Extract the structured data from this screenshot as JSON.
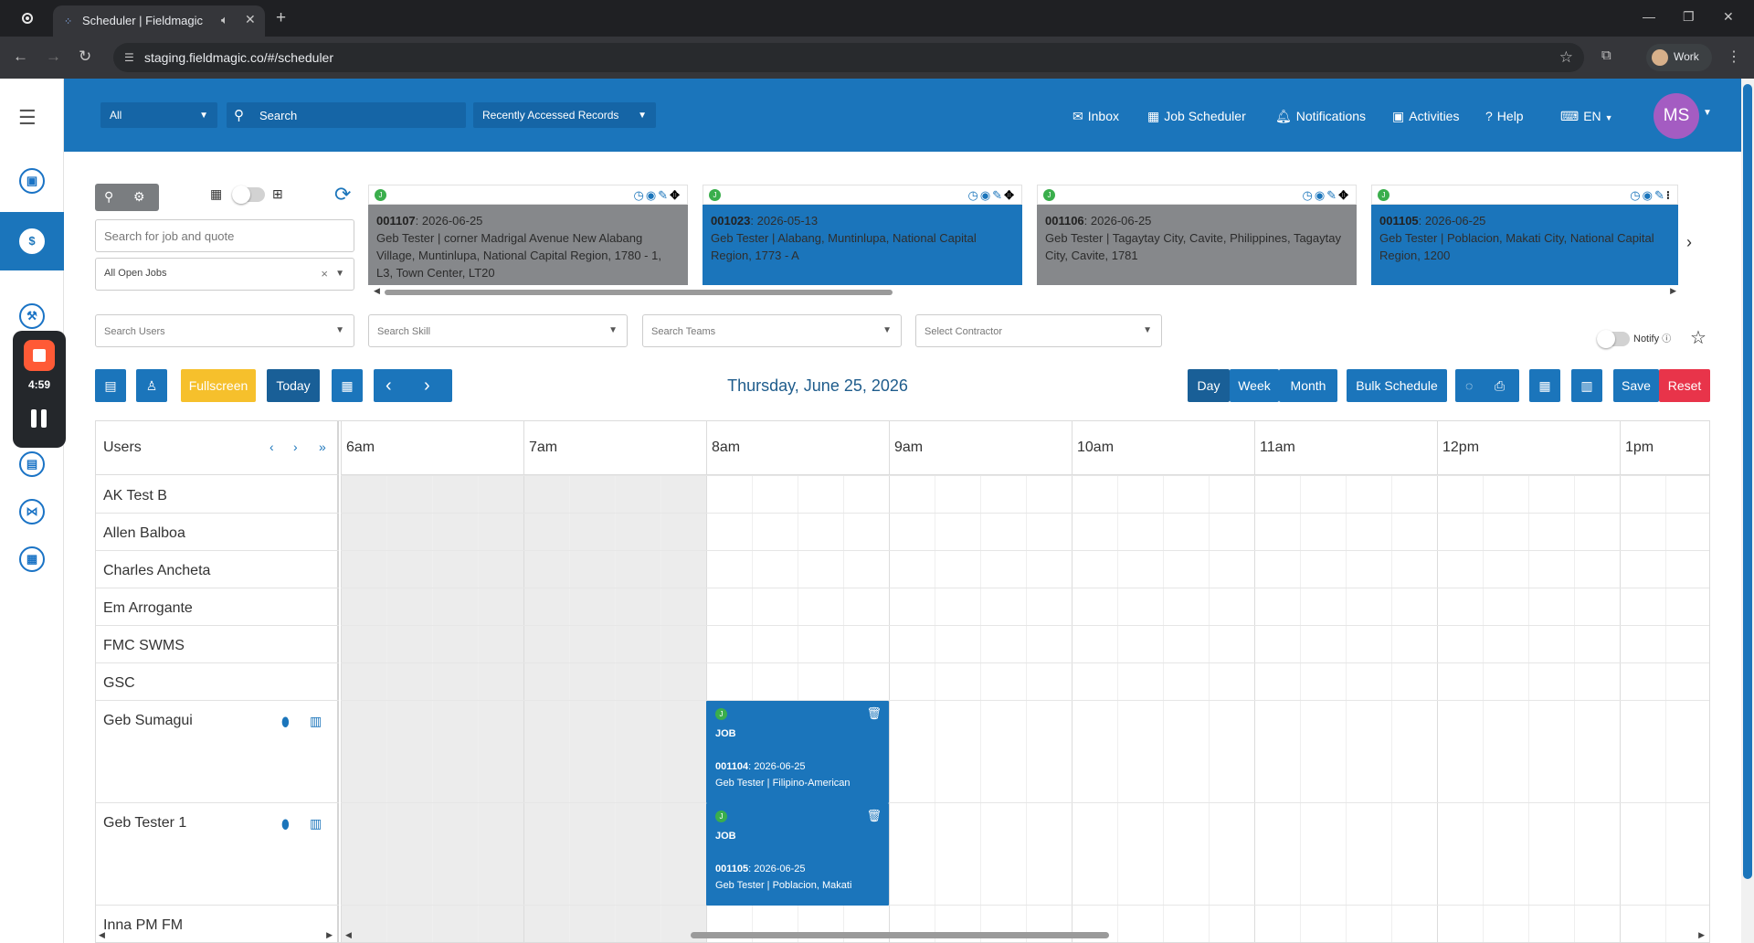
{
  "browser": {
    "tab_title": "Scheduler | Fieldmagic",
    "url": "staging.fieldmagic.co/#/scheduler",
    "profile_label": "Work"
  },
  "recorder": {
    "time": "4:59"
  },
  "header": {
    "scope": "All",
    "search_placeholder": "Search",
    "recent": "Recently Accessed Records",
    "nav": [
      {
        "label": "Inbox",
        "icon": "envelope-icon"
      },
      {
        "label": "Job Scheduler",
        "icon": "calendar-icon"
      },
      {
        "label": "Notifications",
        "icon": "bell-icon"
      },
      {
        "label": "Activities",
        "icon": "briefcase-icon"
      },
      {
        "label": "Help",
        "icon": "question-icon"
      },
      {
        "label": "EN",
        "icon": "language-icon"
      }
    ],
    "avatar_initials": "MS"
  },
  "filters": {
    "job_search_placeholder": "Search for job and quote",
    "job_status": "All Open Jobs",
    "users_placeholder": "Search Users",
    "skill_placeholder": "Search Skill",
    "teams_placeholder": "Search Teams",
    "contractor_placeholder": "Select Contractor",
    "notify_label": "Notify"
  },
  "cards": [
    {
      "id": "001107",
      "date": "2026-06-25",
      "text": "Geb Tester | corner Madrigal Avenue New Alabang Village, Muntinlupa, National Capital Region, 1780 - 1, L3, Town Center, LT20",
      "style": "grey",
      "badge": "J"
    },
    {
      "id": "001023",
      "date": "2026-05-13",
      "text": "Geb Tester | Alabang, Muntinlupa, National Capital Region, 1773 - A",
      "style": "blue",
      "badge": "J"
    },
    {
      "id": "001106",
      "date": "2026-06-25",
      "text": "Geb Tester | Tagaytay City, Cavite, Philippines, Tagaytay City, Cavite, 1781",
      "style": "grey",
      "badge": "J"
    },
    {
      "id": "001105",
      "date": "2026-06-25",
      "text": "Geb Tester | Poblacion, Makati City, National Capital Region, 1200",
      "style": "blue",
      "badge": "J"
    }
  ],
  "toolbar": {
    "fullscreen": "Fullscreen",
    "today": "Today",
    "date": "Thursday, June 25, 2026",
    "day": "Day",
    "week": "Week",
    "month": "Month",
    "bulk": "Bulk Schedule",
    "save": "Save",
    "reset": "Reset"
  },
  "grid": {
    "users_title": "Users",
    "hours": [
      "6am",
      "7am",
      "8am",
      "9am",
      "10am",
      "11am",
      "12pm",
      "1pm"
    ],
    "users": [
      {
        "name": "AK Test B",
        "tall": false
      },
      {
        "name": "Allen Balboa",
        "tall": false
      },
      {
        "name": "Charles Ancheta",
        "tall": false
      },
      {
        "name": "Em Arrogante",
        "tall": false
      },
      {
        "name": "FMC SWMS",
        "tall": false
      },
      {
        "name": "GSC",
        "tall": false
      },
      {
        "name": "Geb Sumagui",
        "tall": true
      },
      {
        "name": "Geb Tester 1",
        "tall": true
      },
      {
        "name": "Inna PM FM",
        "tall": false
      }
    ],
    "events": [
      {
        "type": "JOB",
        "id": "001104",
        "date": "2026-06-25",
        "detail": "Geb Tester | Filipino-American",
        "badge": "J"
      },
      {
        "type": "JOB",
        "id": "001105",
        "date": "2026-06-25",
        "detail": "Geb Tester | Poblacion, Makati",
        "badge": "J"
      }
    ]
  }
}
